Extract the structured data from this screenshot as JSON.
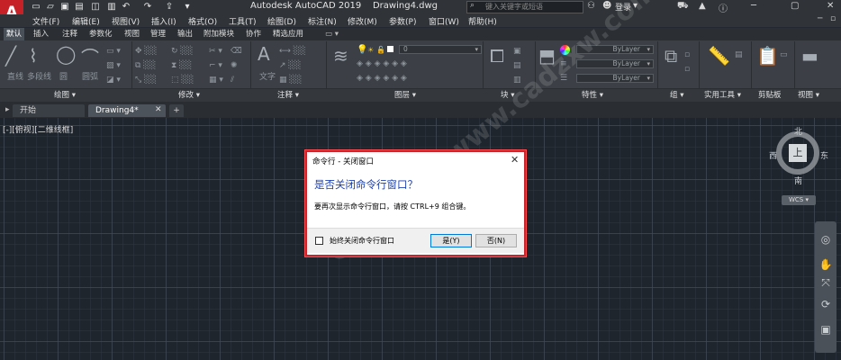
{
  "app": {
    "logo": "A",
    "title": "Autodesk AutoCAD 2019    Drawing4.dwg",
    "search_placeholder": "键入关键字或短语",
    "user_label": "登录"
  },
  "menubar": [
    "文件(F)",
    "编辑(E)",
    "视图(V)",
    "插入(I)",
    "格式(O)",
    "工具(T)",
    "绘图(D)",
    "标注(N)",
    "修改(M)",
    "参数(P)",
    "窗口(W)",
    "帮助(H)"
  ],
  "ribbon_tabs": [
    "默认",
    "插入",
    "注释",
    "参数化",
    "视图",
    "管理",
    "输出",
    "附加模块",
    "协作",
    "精选应用"
  ],
  "ribbon_panels": {
    "draw": "绘图 ▾",
    "modify": "修改 ▾",
    "annotation": "注释 ▾",
    "layers": "图层 ▾",
    "block": "块 ▾",
    "properties": "特性 ▾",
    "groups": "组 ▾",
    "utilities": "实用工具 ▾",
    "clipboard": "剪贴板",
    "view": "视图 ▾"
  },
  "ribbon_buttons": {
    "line": "直线",
    "polyline": "多段线",
    "circle": "圆",
    "arc": "圆弧",
    "text": "文字",
    "layer_value": "0",
    "bylayer_1": "ByLayer",
    "bylayer_2": "ByLayer",
    "bylayer_3": "ByLayer"
  },
  "doc_tabs": {
    "start": "开始",
    "drawing": "Drawing4*",
    "add": "+"
  },
  "viewport_label": "[-][俯视][二维线框]",
  "viewcube": {
    "top": "上",
    "north": "北",
    "south": "南",
    "east": "东",
    "west": "西",
    "wcs": "WCS ▾"
  },
  "dialog": {
    "title": "命令行 - 关闭窗口",
    "heading": "是否关闭命令行窗口？",
    "message": "要再次显示命令行窗口，请按 CTRL+9 组合键。",
    "checkbox_label": "始终关闭命令行窗口",
    "yes_label": "是(Y)",
    "no_label": "否(N)"
  },
  "watermark": "CAD自学网 www.cadzxw.com"
}
